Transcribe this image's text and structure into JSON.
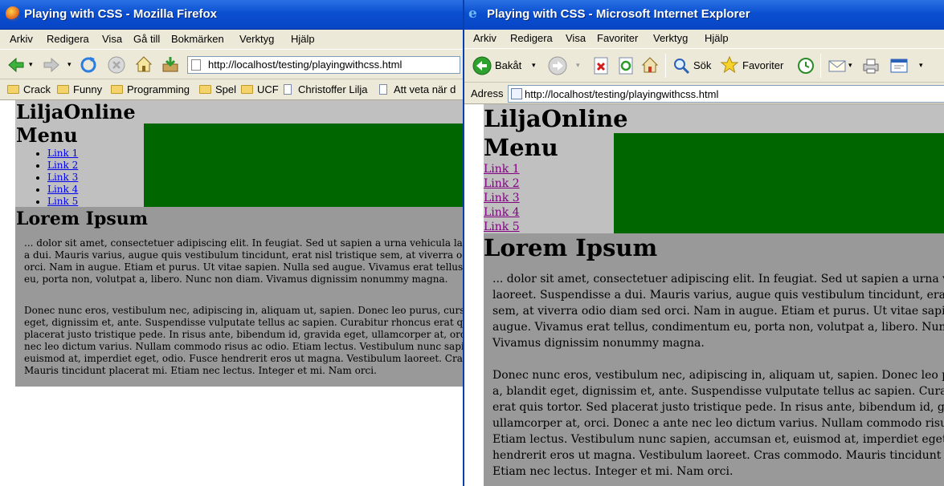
{
  "firefox": {
    "title": "Playing with CSS - Mozilla Firefox",
    "menu": [
      "Arkiv",
      "Redigera",
      "Visa",
      "Gå till",
      "Bokmärken",
      "Verktyg",
      "Hjälp"
    ],
    "url": "http://localhost/testing/playingwithcss.html",
    "bookmarks": [
      {
        "label": "Crack",
        "icon": "folder-icon"
      },
      {
        "label": "Funny",
        "icon": "folder-icon"
      },
      {
        "label": "Programming",
        "icon": "folder-icon"
      },
      {
        "label": "Spel",
        "icon": "folder-icon"
      },
      {
        "label": "UCF",
        "icon": "folder-icon"
      },
      {
        "label": "Christoffer Lilja",
        "icon": "page-icon"
      },
      {
        "label": "Att veta när d",
        "icon": "page-icon"
      }
    ]
  },
  "ie": {
    "title": "Playing with CSS - Microsoft Internet Explorer",
    "menu": [
      "Arkiv",
      "Redigera",
      "Visa",
      "Favoriter",
      "Verktyg",
      "Hjälp"
    ],
    "back_label": "Bakåt",
    "search_label": "Sök",
    "favorites_label": "Favoriter",
    "address_label": "Adress",
    "url": "http://localhost/testing/playingwithcss.html"
  },
  "page": {
    "logo": "LiljaOnline",
    "menu_heading": "Menu",
    "links": [
      "Link 1",
      "Link 2",
      "Link 3",
      "Link 4",
      "Link 5"
    ],
    "heading": "Lorem Ipsum",
    "ff_paragraph1_lines": [
      "... dolor sit amet, consectetuer adipiscing elit. In feugiat. Sed ut sapien a urna vehicula laoreet.",
      "a dui. Mauris varius, augue quis vestibulum tincidunt, erat nisl tristique sem, at viverra odio",
      "orci. Nam in augue. Etiam et purus. Ut vitae sapien. Nulla sed augue. Vivamus erat tellus, con",
      "eu, porta non, volutpat a, libero. Nunc non diam. Vivamus dignissim nonummy magna."
    ],
    "ff_paragraph2_lines": [
      "Donec nunc eros, vestibulum nec, adipiscing in, aliquam ut, sapien. Donec leo purus, cursus a,",
      "eget, dignissim et, ante. Suspendisse vulputate tellus ac sapien. Curabitur rhoncus erat quis tor",
      "placerat justo tristique pede. In risus ante, bibendum id, gravida eget, ullamcorper at, orci. Do",
      "nec leo dictum varius. Nullam commodo risus ac odio. Etiam lectus. Vestibulum nunc sapien, a",
      "euismod at, imperdiet eget, odio. Fusce hendrerit eros ut magna. Vestibulum laoreet. Cras com",
      "Mauris tincidunt placerat mi. Etiam nec lectus. Integer et mi. Nam orci."
    ],
    "ie_paragraph1_lines": [
      "... dolor sit amet, consectetuer adipiscing elit. In feugiat. Sed ut sapien a urna vehicula",
      "laoreet. Suspendisse a dui. Mauris varius, augue quis vestibulum tincidunt, erat nisl tr",
      "sem, at viverra odio diam sed orci. Nam in augue. Etiam et purus. Ut vitae sapien. Nu",
      "augue. Vivamus erat tellus, condimentum eu, porta non, volutpat a, libero. Nunc non",
      "Vivamus dignissim nonummy magna."
    ],
    "ie_paragraph2_lines": [
      "Donec nunc eros, vestibulum nec, adipiscing in, aliquam ut, sapien. Donec leo purus,",
      "a, blandit eget, dignissim et, ante. Suspendisse vulputate tellus ac sapien. Curabitur rh",
      "erat quis tortor. Sed placerat justo tristique pede. In risus ante, bibendum id, gravida e",
      "ullamcorper at, orci. Donec a ante nec leo dictum varius. Nullam commodo risus ac o",
      "Etiam lectus. Vestibulum nunc sapien, accumsan et, euismod at, imperdiet eget, odio",
      "hendrerit eros ut magna. Vestibulum laoreet. Cras commodo. Mauris tincidunt placer",
      "Etiam nec lectus. Integer et mi. Nam orci."
    ]
  },
  "colors": {
    "logo_bg": "#c0c0c0",
    "green_box": "#006600",
    "lorem_bg": "#999999",
    "titlebar": "#0a4fd0"
  }
}
